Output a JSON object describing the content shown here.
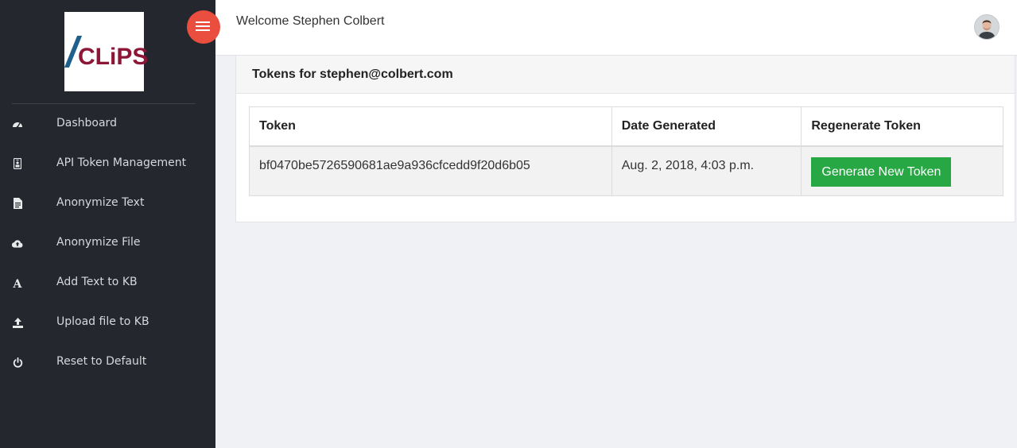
{
  "sidebar": {
    "logo_text": "CLiPS",
    "items": [
      {
        "label": "Dashboard",
        "icon": "dashboard-icon"
      },
      {
        "label": "API Token Management",
        "icon": "id-badge-icon"
      },
      {
        "label": "Anonymize Text",
        "icon": "file-text-icon"
      },
      {
        "label": "Anonymize File",
        "icon": "cloud-upload-icon"
      },
      {
        "label": "Add Text to KB",
        "icon": "font-icon"
      },
      {
        "label": "Upload file to KB",
        "icon": "upload-icon"
      },
      {
        "label": "Reset to Default",
        "icon": "power-icon"
      }
    ]
  },
  "header": {
    "welcome": "Welcome Stephen Colbert"
  },
  "card": {
    "title": "Tokens for stephen@colbert.com",
    "columns": [
      "Token",
      "Date Generated",
      "Regenerate Token"
    ],
    "rows": [
      {
        "token": "bf0470be5726590681ae9a936cfcedd9f20d6b05",
        "date": "Aug. 2, 2018, 4:03 p.m.",
        "button_label": "Generate New Token"
      }
    ]
  },
  "colors": {
    "sidebar_bg": "#24272e",
    "toggle_accent": "#e94e3f",
    "button_green": "#28a745",
    "logo_red": "#8c1635"
  }
}
